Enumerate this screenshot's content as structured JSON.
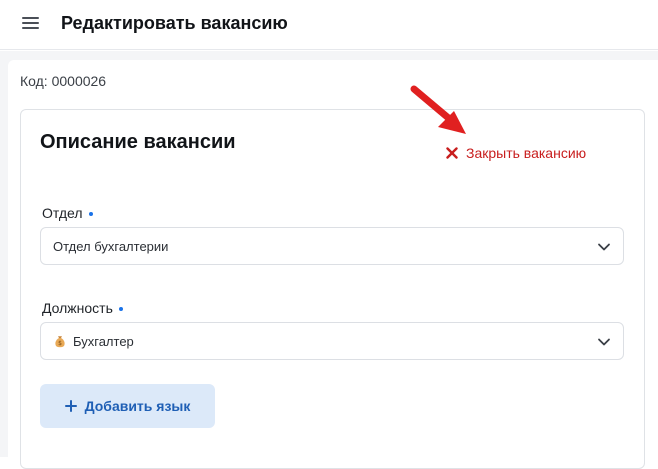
{
  "header": {
    "title": "Редактировать вакансию",
    "menu_icon": "hamburger-menu-icon"
  },
  "vacancy": {
    "code_text": "Код: 0000026"
  },
  "card": {
    "title": "Описание вакансии",
    "close_label": "Закрыть вакансию",
    "close_icon": "close-x-icon",
    "close_color": "#c81e1e",
    "annotation_arrow_color": "#e02020"
  },
  "fields": {
    "department": {
      "label": "Отдел",
      "value": "Отдел бухгалтерии",
      "required": true
    },
    "position": {
      "label": "Должность",
      "value": "Бухгалтер",
      "icon": "money-bag-icon",
      "required": true
    }
  },
  "actions": {
    "add_language_label": "Добавить язык",
    "accent_color": "#1f5fb5"
  }
}
